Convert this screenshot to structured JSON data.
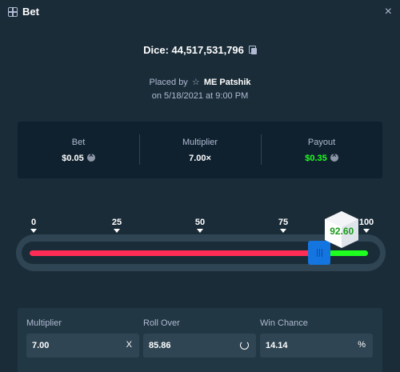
{
  "header": {
    "title": "Bet",
    "close_label": "×"
  },
  "dice": {
    "text": "Dice: 44,517,531,796"
  },
  "placed": {
    "prefix": "Placed by",
    "user": "ME Patshik",
    "date": "on 5/18/2021 at 9:00 PM"
  },
  "stats": {
    "bet_label": "Bet",
    "bet_value": "$0.05",
    "multiplier_label": "Multiplier",
    "multiplier_value": "7.00×",
    "payout_label": "Payout",
    "payout_value": "$0.35"
  },
  "slider": {
    "ticks": [
      "0",
      "25",
      "50",
      "75",
      "100"
    ],
    "roll_over": 85.86,
    "result": "92.60",
    "result_value": 92.6,
    "colors": {
      "lose": "#ff2d55",
      "win": "#1fff20",
      "handle": "#1475e1"
    }
  },
  "inputs": {
    "multiplier_label": "Multiplier",
    "multiplier_value": "7.00",
    "multiplier_suffix": "X",
    "roll_over_label": "Roll Over",
    "roll_over_value": "85.86",
    "win_chance_label": "Win Chance",
    "win_chance_value": "14.14",
    "win_chance_suffix": "%"
  },
  "icons": [
    "bet-icon",
    "close-icon",
    "copy-icon",
    "star-icon",
    "coin-icon",
    "refresh-icon"
  ]
}
